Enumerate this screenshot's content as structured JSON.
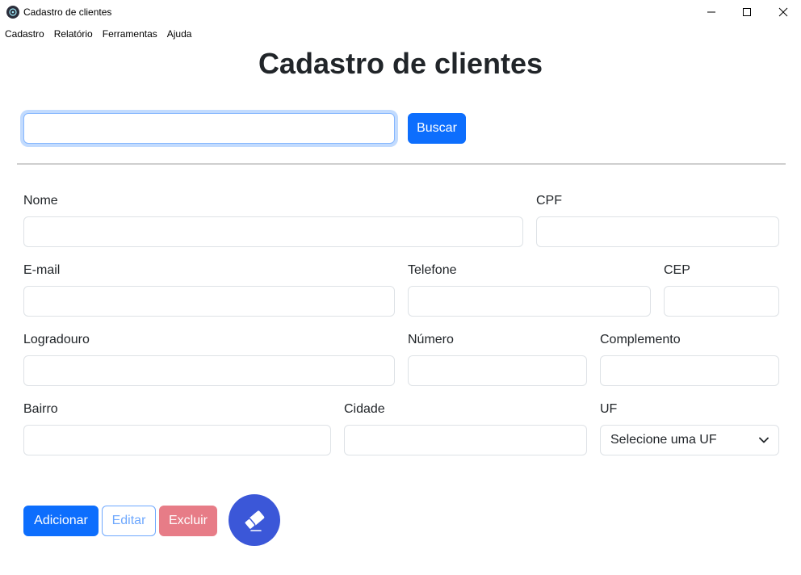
{
  "window": {
    "title": "Cadastro de clientes"
  },
  "menu": {
    "items": [
      "Cadastro",
      "Relatório",
      "Ferramentas",
      "Ajuda"
    ]
  },
  "page": {
    "title": "Cadastro de clientes"
  },
  "search": {
    "value": "",
    "button_label": "Buscar"
  },
  "form": {
    "nome": {
      "label": "Nome",
      "value": ""
    },
    "cpf": {
      "label": "CPF",
      "value": ""
    },
    "email": {
      "label": "E-mail",
      "value": ""
    },
    "telefone": {
      "label": "Telefone",
      "value": ""
    },
    "cep": {
      "label": "CEP",
      "value": ""
    },
    "logradouro": {
      "label": "Logradouro",
      "value": ""
    },
    "numero": {
      "label": "Número",
      "value": ""
    },
    "complemento": {
      "label": "Complemento",
      "value": ""
    },
    "bairro": {
      "label": "Bairro",
      "value": ""
    },
    "cidade": {
      "label": "Cidade",
      "value": ""
    },
    "uf": {
      "label": "UF",
      "selected": "Selecione uma UF"
    }
  },
  "actions": {
    "add_label": "Adicionar",
    "edit_label": "Editar",
    "delete_label": "Excluir",
    "clear_icon": "eraser-icon"
  },
  "colors": {
    "primary": "#0d6efd",
    "danger_disabled": "#e77c87",
    "outline_disabled": "#6ea8fe",
    "fab": "#3b57d8"
  }
}
